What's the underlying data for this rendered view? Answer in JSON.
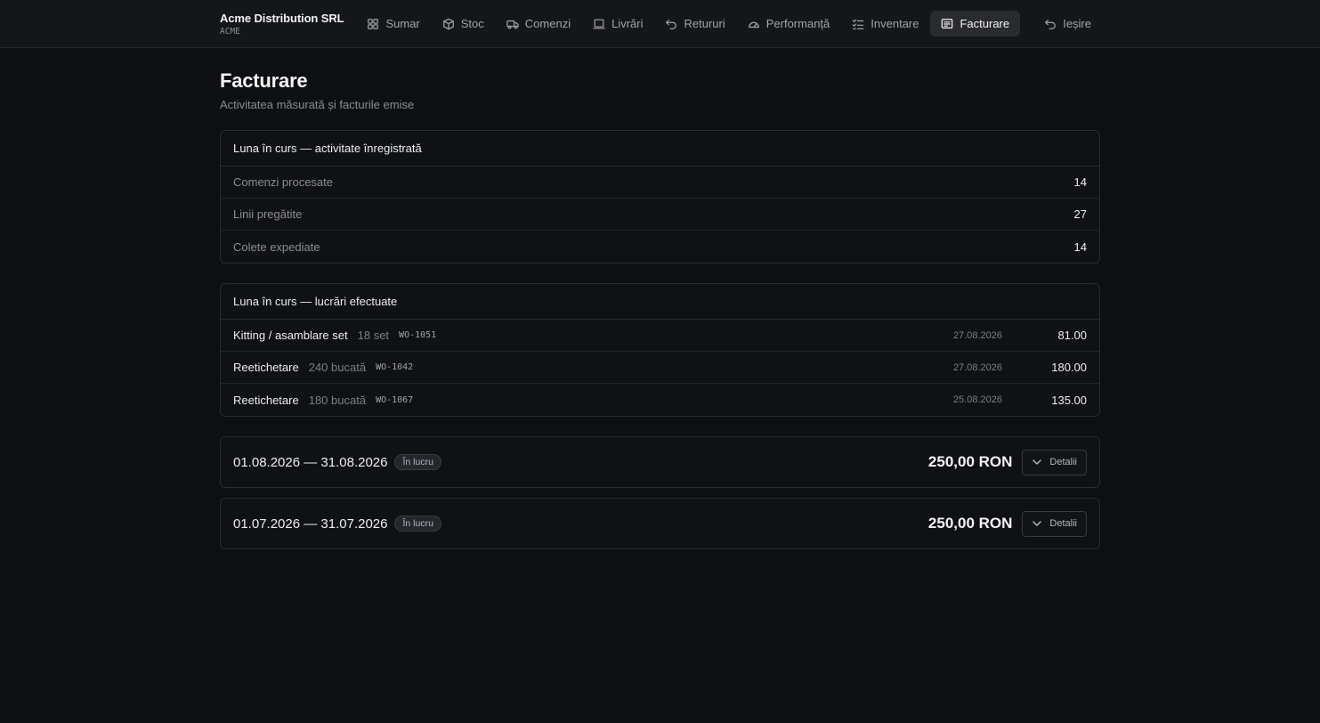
{
  "brand": {
    "name": "Acme Distribution SRL",
    "code": "ACME"
  },
  "nav": {
    "items": [
      {
        "label": "Sumar",
        "icon": "grid-icon"
      },
      {
        "label": "Stoc",
        "icon": "box-icon"
      },
      {
        "label": "Comenzi",
        "icon": "truck-icon"
      },
      {
        "label": "Livrări",
        "icon": "tray-icon"
      },
      {
        "label": "Retururi",
        "icon": "return-arrow-icon"
      },
      {
        "label": "Performanță",
        "icon": "gauge-icon"
      },
      {
        "label": "Inventare",
        "icon": "checklist-icon"
      },
      {
        "label": "Facturare",
        "icon": "invoice-icon",
        "active": true
      }
    ],
    "logout": "Ieșire"
  },
  "page": {
    "title": "Facturare",
    "subtitle": "Activitatea măsurată și facturile emise"
  },
  "activity": {
    "title": "Luna în curs — activitate înregistrată",
    "rows": [
      {
        "label": "Comenzi procesate",
        "value": "14"
      },
      {
        "label": "Linii pregătite",
        "value": "27"
      },
      {
        "label": "Colete expediate",
        "value": "14"
      }
    ]
  },
  "work": {
    "title": "Luna în curs — lucrări efectuate",
    "rows": [
      {
        "name": "Kitting / asamblare set",
        "qty": "18 set",
        "code": "WO-1051",
        "date": "27.08.2026",
        "amount": "81.00"
      },
      {
        "name": "Reetichetare",
        "qty": "240 bucată",
        "code": "WO-1042",
        "date": "27.08.2026",
        "amount": "180.00"
      },
      {
        "name": "Reetichetare",
        "qty": "180 bucată",
        "code": "WO-1067",
        "date": "25.08.2026",
        "amount": "135.00"
      }
    ]
  },
  "invoices": [
    {
      "period": "01.08.2026 — 31.08.2026",
      "status": "În lucru",
      "total": "250,00 RON",
      "details_label": "Detalii"
    },
    {
      "period": "01.07.2026 — 31.07.2026",
      "status": "În lucru",
      "total": "250,00 RON",
      "details_label": "Detalii"
    }
  ]
}
